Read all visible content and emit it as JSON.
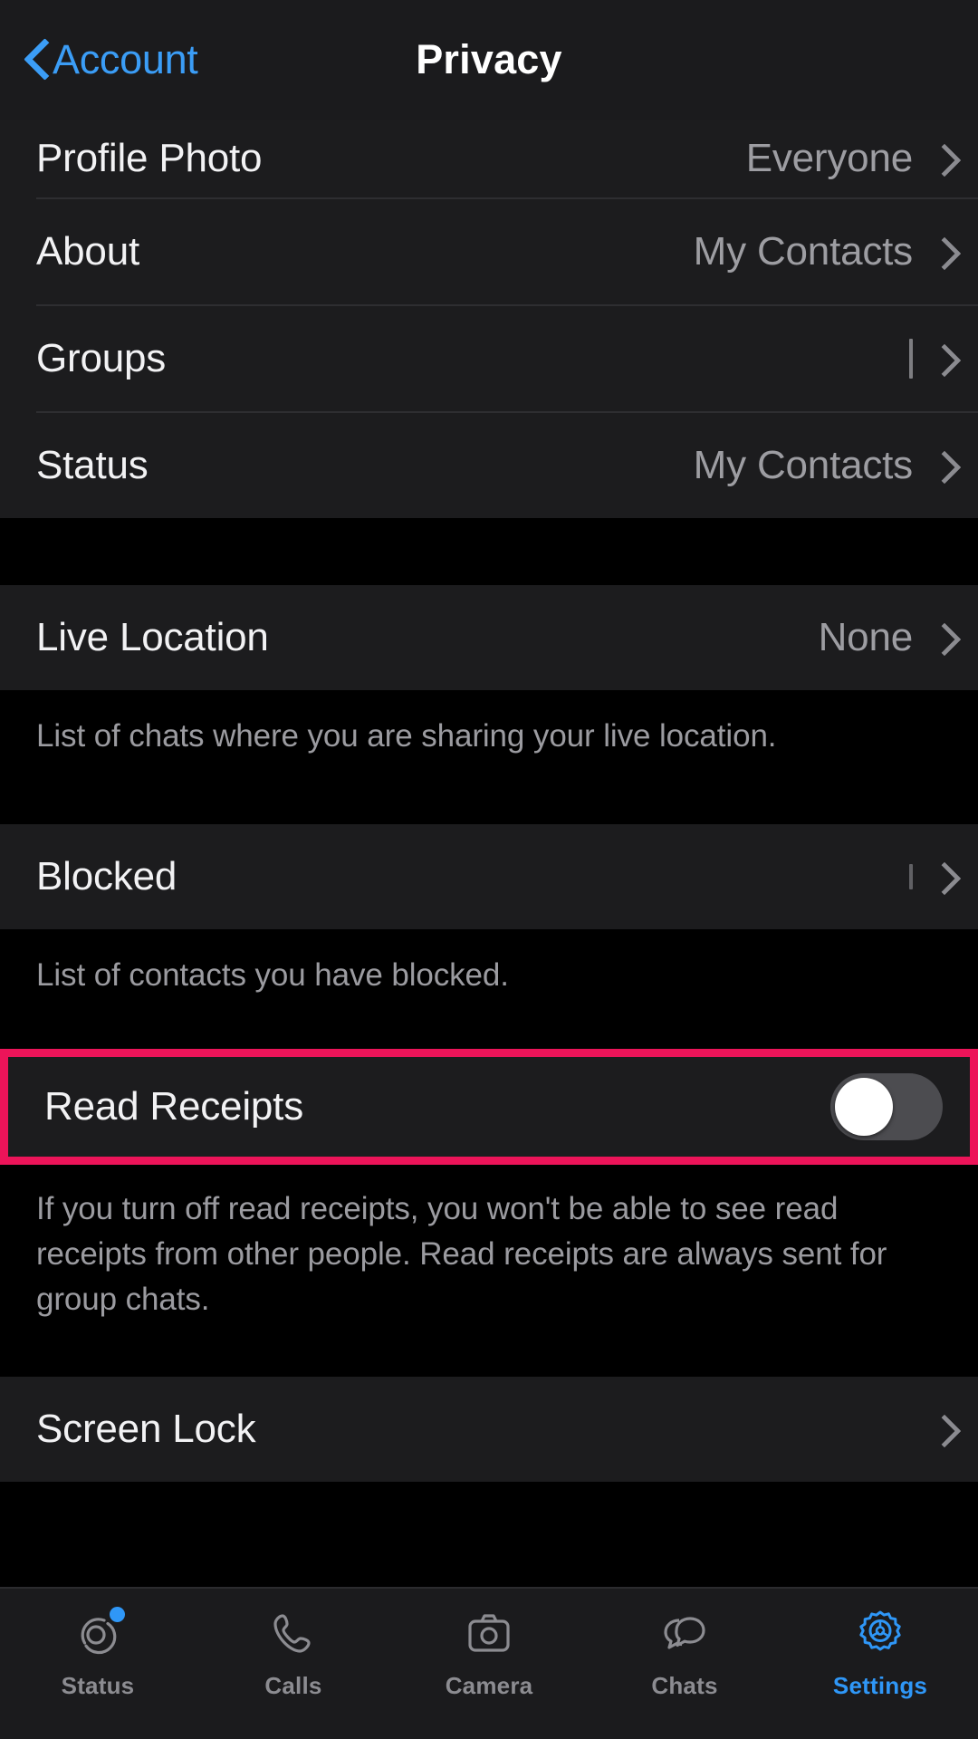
{
  "nav": {
    "back_label": "Account",
    "back_icon": "chevron-left-icon",
    "title": "Privacy"
  },
  "sections": {
    "visibility": {
      "rows": [
        {
          "label": "Profile Photo",
          "value": "Everyone",
          "accessory": "chevron-right-icon"
        },
        {
          "label": "About",
          "value": "My Contacts",
          "accessory": "chevron-right-icon"
        },
        {
          "label": "Groups",
          "value": "",
          "accessory": "chevron-right-icon"
        },
        {
          "label": "Status",
          "value": "My Contacts",
          "accessory": "chevron-right-icon"
        }
      ]
    },
    "live_location": {
      "row": {
        "label": "Live Location",
        "value": "None",
        "accessory": "chevron-right-icon"
      },
      "footer": "List of chats where you are sharing your live location."
    },
    "blocked": {
      "row": {
        "label": "Blocked",
        "value": "",
        "accessory": "chevron-right-icon"
      },
      "footer": "List of contacts you have blocked."
    },
    "read_receipts": {
      "row": {
        "label": "Read Receipts",
        "toggle_state": "off",
        "accessory": "toggle-switch"
      },
      "footer": "If you turn off read receipts, you won't be able to see read receipts from other people. Read receipts are always sent for group chats.",
      "highlight_color": "#ec1459"
    },
    "screen_lock": {
      "row": {
        "label": "Screen Lock",
        "value": "",
        "accessory": "chevron-right-icon"
      }
    }
  },
  "tabbar": {
    "items": [
      {
        "label": "Status",
        "icon": "status-rings-icon",
        "active": false,
        "badge": true
      },
      {
        "label": "Calls",
        "icon": "phone-icon",
        "active": false,
        "badge": false
      },
      {
        "label": "Camera",
        "icon": "camera-icon",
        "active": false,
        "badge": false
      },
      {
        "label": "Chats",
        "icon": "chat-bubbles-icon",
        "active": false,
        "badge": false
      },
      {
        "label": "Settings",
        "icon": "gear-icon",
        "active": true,
        "badge": false
      }
    ],
    "active_color": "#2f97f7",
    "inactive_color": "#8c8c91"
  }
}
